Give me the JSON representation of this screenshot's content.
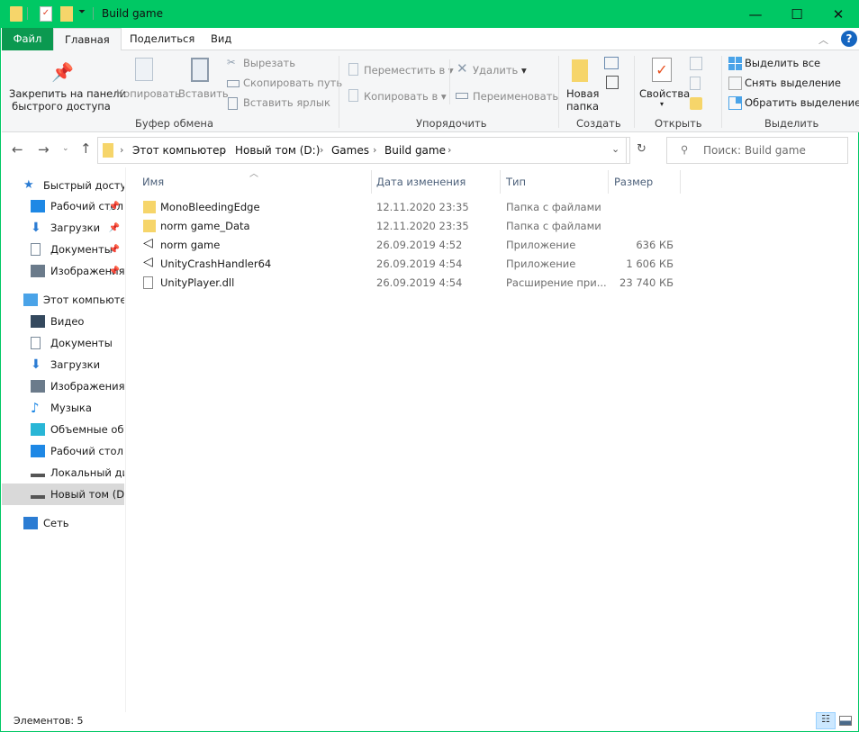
{
  "window": {
    "title": "Build game",
    "accent": "#00c864",
    "file_tab_color": "#0b9950"
  },
  "window_controls": {
    "minimize": "—",
    "maximize": "☐",
    "close": "✕"
  },
  "ribbon_tabs": [
    "Файл",
    "Главная",
    "Поделиться",
    "Вид"
  ],
  "ribbon": {
    "clipboard": {
      "pin": "Закрепить на панели",
      "pin2": "быстрого доступа",
      "copy": "Копировать",
      "paste": "Вставить",
      "cut": "Вырезать",
      "copy_path": "Скопировать путь",
      "paste_shortcut": "Вставить ярлык",
      "group": "Буфер обмена"
    },
    "organize": {
      "move": "Переместить в",
      "copy_to": "Копировать в",
      "delete": "Удалить",
      "rename": "Переименовать",
      "group": "Упорядочить"
    },
    "new": {
      "new_folder": "Новая",
      "new_folder2": "папка",
      "group": "Создать"
    },
    "open": {
      "properties": "Свойства",
      "group": "Открыть"
    },
    "select": {
      "select_all": "Выделить все",
      "select_none": "Снять выделение",
      "invert": "Обратить выделение",
      "group": "Выделить"
    }
  },
  "address": {
    "crumbs": [
      "Этот компьютер",
      "Новый том (D:)",
      "Games",
      "Build game"
    ],
    "search_placeholder": "Поиск: Build game"
  },
  "nav": [
    {
      "label": "Быстрый доступ",
      "icon": "star-icon",
      "color": "#2b7cd3",
      "level": 0
    },
    {
      "label": "Рабочий стол",
      "icon": "desktop-icon",
      "color": "#1e88e5",
      "level": 1,
      "pinned": true
    },
    {
      "label": "Загрузки",
      "icon": "download-icon",
      "color": "#2b7cd3",
      "level": 1,
      "pinned": true
    },
    {
      "label": "Документы",
      "icon": "document-icon",
      "color": "#7a8a9a",
      "level": 1,
      "pinned": true
    },
    {
      "label": "Изображения",
      "icon": "pictures-icon",
      "color": "#6b7b8b",
      "level": 1,
      "pinned": true
    },
    {
      "label": "Этот компьютер",
      "icon": "computer-icon",
      "color": "#4aa3e8",
      "level": 0
    },
    {
      "label": "Видео",
      "icon": "video-icon",
      "color": "#34495e",
      "level": 1
    },
    {
      "label": "Документы",
      "icon": "document-icon",
      "color": "#7a8a9a",
      "level": 1
    },
    {
      "label": "Загрузки",
      "icon": "download-icon",
      "color": "#2b7cd3",
      "level": 1
    },
    {
      "label": "Изображения",
      "icon": "pictures-icon",
      "color": "#6b7b8b",
      "level": 1
    },
    {
      "label": "Музыка",
      "icon": "music-icon",
      "color": "#1e88e5",
      "level": 1
    },
    {
      "label": "Объемные объекты",
      "icon": "3d-objects-icon",
      "color": "#29b6d6",
      "level": 1
    },
    {
      "label": "Рабочий стол",
      "icon": "desktop-icon",
      "color": "#1e88e5",
      "level": 1
    },
    {
      "label": "Локальный диск (C:)",
      "icon": "drive-icon",
      "color": "#555",
      "level": 1
    },
    {
      "label": "Новый том (D:)",
      "icon": "drive-icon",
      "color": "#555",
      "level": 1,
      "selected": true
    },
    {
      "label": "Сеть",
      "icon": "network-icon",
      "color": "#2b7cd3",
      "level": 0
    }
  ],
  "columns": [
    "Имя",
    "Дата изменения",
    "Тип",
    "Размер"
  ],
  "files": [
    {
      "name": "MonoBleedingEdge",
      "date": "12.11.2020 23:35",
      "type": "Папка с файлами",
      "size": "",
      "icon": "folder-icon"
    },
    {
      "name": "norm game_Data",
      "date": "12.11.2020 23:35",
      "type": "Папка с файлами",
      "size": "",
      "icon": "folder-icon"
    },
    {
      "name": "norm game",
      "date": "26.09.2019 4:52",
      "type": "Приложение",
      "size": "636 КБ",
      "icon": "unity-icon"
    },
    {
      "name": "UnityCrashHandler64",
      "date": "26.09.2019 4:54",
      "type": "Приложение",
      "size": "1 606 КБ",
      "icon": "unity-icon"
    },
    {
      "name": "UnityPlayer.dll",
      "date": "26.09.2019 4:54",
      "type": "Расширение при...",
      "size": "23 740 КБ",
      "icon": "dll-icon"
    }
  ],
  "status": {
    "count": "Элементов: 5"
  }
}
